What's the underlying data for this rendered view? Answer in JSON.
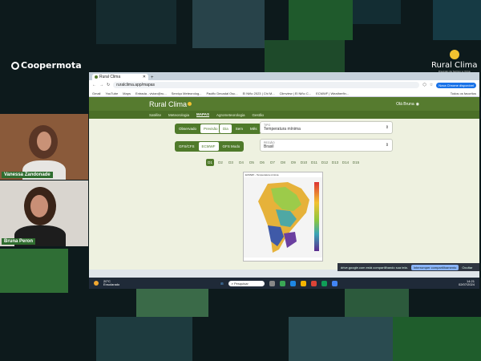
{
  "stage": {
    "left_logo": "Coopermota",
    "right_logo": "Rural Clima",
    "right_logo_tagline": "Previsão de tempo e clima"
  },
  "participants": [
    {
      "name": "Vanessa Zandonade"
    },
    {
      "name": "Bruna Peron"
    }
  ],
  "browser": {
    "tab_title": "Rural Clima",
    "url": "ruralclima.app/mapas",
    "profile_button": "Nova Chrome disponível",
    "bookmarks": [
      "Gmail",
      "YouTube",
      "Maps",
      "Entrada - vivian@ru...",
      "Serviço Meteorolog...",
      "Pacific Decadal Osc...",
      "El Niño 2023 | Chi M...",
      "Climview | El Niño C...",
      "ECMWF | Weatherfin..."
    ],
    "bookmarks_right": "Todos os favoritos"
  },
  "site": {
    "brand": "Rural Clima",
    "greeting": "Olá Bruna",
    "nav": [
      "Satélite",
      "Meteorologia",
      "MAPAS",
      "Agrometeorologia",
      "Gestão"
    ],
    "nav_active": "MAPAS",
    "mode_buttons": [
      "Observado",
      "Previsão"
    ],
    "mode_active": "Previsão",
    "period_buttons": [
      "Dia",
      "Sem",
      "Mês"
    ],
    "period_active": "Dia",
    "model_buttons": [
      "GFS/CFS",
      "ECMWF",
      "GFS Modo"
    ],
    "model_active": "ECMWF",
    "variable_select": {
      "label": "TIPO",
      "value": "Temperatura mínima"
    },
    "region_select": {
      "label": "REGIÃO",
      "value": "Brasil"
    },
    "days": [
      "D1",
      "D2",
      "D3",
      "D4",
      "D5",
      "D6",
      "D7",
      "D8",
      "D9",
      "D10",
      "D11",
      "D12",
      "D13",
      "D14",
      "D15"
    ],
    "day_active": "D1",
    "map_title": "ECMWF - Temperatura mínima"
  },
  "share_bar": {
    "text": "drive.google.com está compartilhando sua tela.",
    "stop": "Interromper compartilhamento",
    "hide": "Ocultar"
  },
  "taskbar": {
    "weather_temp": "20°C",
    "weather_desc": "Ensolarado",
    "search": "Pesquisar",
    "time": "14:21",
    "date": "02/07/2024"
  },
  "colors": {
    "brand_green": "#567b2f",
    "dark_green": "#4f7a2a"
  }
}
